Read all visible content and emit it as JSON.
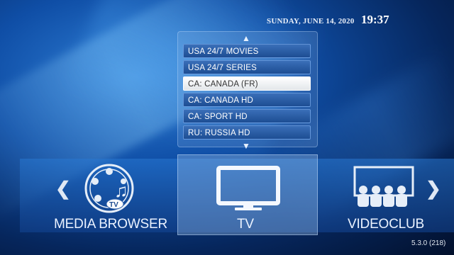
{
  "header": {
    "date": "SUNDAY, JUNE 14, 2020",
    "time": "19:37"
  },
  "channels": {
    "items": [
      "USA 24/7 MOVIES",
      "USA 24/7 SERIES",
      "CA: CANADA (FR)",
      "CA: CANADA HD",
      "CA: SPORT HD",
      "RU: RUSSIA HD"
    ],
    "selected": "CA: CANADA (FR)"
  },
  "menu": {
    "media_browser": "MEDIA BROWSER",
    "tv": "TV",
    "videoclub": "VIDEOCLUB",
    "selected": "TV"
  },
  "icons": {
    "scroll_up": "chevron-up",
    "scroll_down": "chevron-down",
    "nav_left": "chevron-left",
    "nav_right": "chevron-right",
    "media_browser": "film-reel-music-tv-icon",
    "tv": "tv-monitor-icon",
    "videoclub": "cinema-audience-icon"
  },
  "version": "5.3.0 (218)"
}
